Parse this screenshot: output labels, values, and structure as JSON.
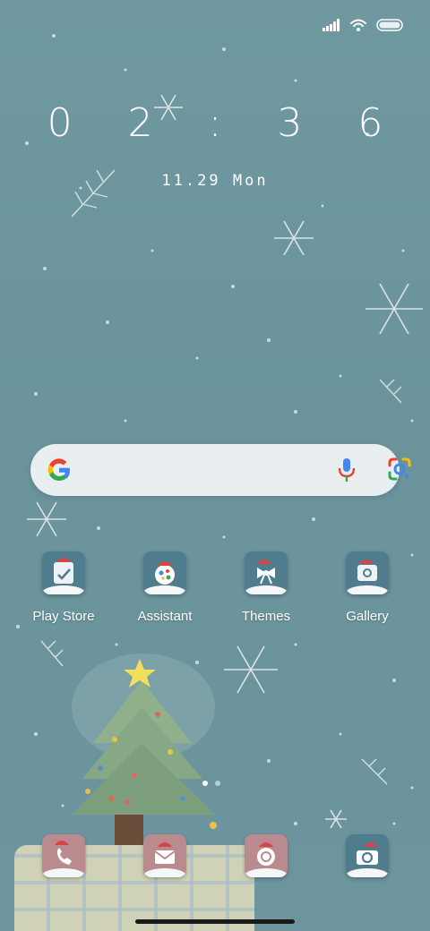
{
  "status": {
    "icons": [
      "cellular-signal-icon",
      "wifi-icon",
      "battery-icon"
    ]
  },
  "clock": {
    "time": "0 2 : 3 6"
  },
  "date": {
    "text": "11.29 Mon"
  },
  "search": {
    "icons": [
      "google-logo-icon",
      "microphone-icon",
      "google-lens-icon"
    ]
  },
  "apps": [
    {
      "label": "Play Store",
      "icon": "play-store-icon"
    },
    {
      "label": "Assistant",
      "icon": "assistant-icon"
    },
    {
      "label": "Themes",
      "icon": "themes-icon"
    },
    {
      "label": "Gallery",
      "icon": "gallery-icon"
    }
  ],
  "dock": [
    {
      "icon": "phone-icon"
    },
    {
      "icon": "messages-icon"
    },
    {
      "icon": "browser-icon"
    },
    {
      "icon": "camera-icon"
    }
  ],
  "pages": {
    "count": 2,
    "current": 1
  },
  "colors": {
    "wallpaper": "#6d959e",
    "search_bar": "#e9eef0",
    "icon_teal": "#4f7d8d",
    "icon_pink": "#b98a8e"
  }
}
